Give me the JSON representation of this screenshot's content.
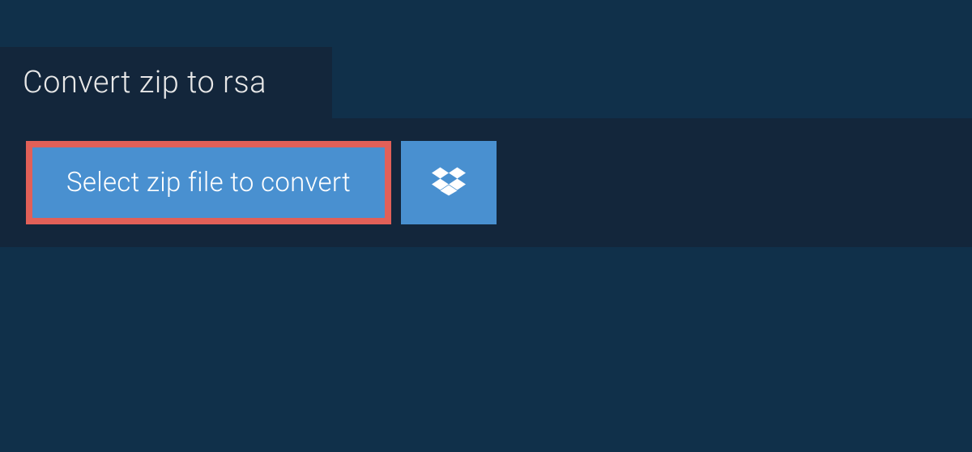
{
  "header": {
    "title": "Convert zip to rsa"
  },
  "actions": {
    "select_label": "Select zip file to convert",
    "dropbox_icon": "dropbox-icon"
  },
  "colors": {
    "bg": "#10304a",
    "panel": "#13263b",
    "button": "#4990d0",
    "highlight_border": "#e16058",
    "text_light": "#e8e8e8",
    "text_white": "#ffffff"
  }
}
